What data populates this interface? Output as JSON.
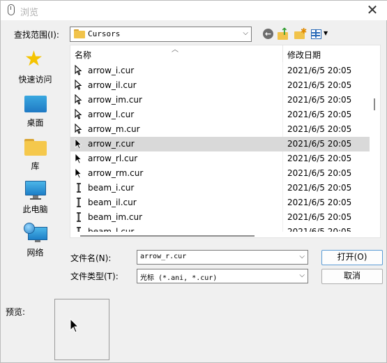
{
  "window": {
    "title": "浏览",
    "close_glyph": "✕"
  },
  "lookin": {
    "label": "查找范围(I):",
    "value": "Cursors",
    "icon": "folder-icon"
  },
  "toolbar": {
    "back_icon": "back-arrow-icon",
    "up_icon": "up-folder-icon",
    "new_folder_icon": "new-folder-icon",
    "view_menu_icon": "view-menu-icon"
  },
  "places": [
    {
      "label": "快速访问",
      "icon": "star-icon"
    },
    {
      "label": "桌面",
      "icon": "desktop-icon"
    },
    {
      "label": "库",
      "icon": "library-icon"
    },
    {
      "label": "此电脑",
      "icon": "computer-icon"
    },
    {
      "label": "网络",
      "icon": "network-icon"
    }
  ],
  "filelist": {
    "columns": {
      "name": "名称",
      "modified": "修改日期"
    },
    "rows": [
      {
        "name": "arrow_i.cur",
        "date": "2021/6/5 20:05",
        "kind": "arrow",
        "selected": false
      },
      {
        "name": "arrow_il.cur",
        "date": "2021/6/5 20:05",
        "kind": "arrow",
        "selected": false
      },
      {
        "name": "arrow_im.cur",
        "date": "2021/6/5 20:05",
        "kind": "arrow",
        "selected": false
      },
      {
        "name": "arrow_l.cur",
        "date": "2021/6/5 20:05",
        "kind": "arrow",
        "selected": false
      },
      {
        "name": "arrow_m.cur",
        "date": "2021/6/5 20:05",
        "kind": "arrow",
        "selected": false
      },
      {
        "name": "arrow_r.cur",
        "date": "2021/6/5 20:05",
        "kind": "arrow-black",
        "selected": true
      },
      {
        "name": "arrow_rl.cur",
        "date": "2021/6/5 20:05",
        "kind": "arrow-black",
        "selected": false
      },
      {
        "name": "arrow_rm.cur",
        "date": "2021/6/5 20:05",
        "kind": "arrow-black",
        "selected": false
      },
      {
        "name": "beam_i.cur",
        "date": "2021/6/5 20:05",
        "kind": "beam",
        "selected": false
      },
      {
        "name": "beam_il.cur",
        "date": "2021/6/5 20:05",
        "kind": "beam",
        "selected": false
      },
      {
        "name": "beam_im.cur",
        "date": "2021/6/5 20:05",
        "kind": "beam",
        "selected": false
      },
      {
        "name": "beam_l.cur",
        "date": "2021/6/5 20:05",
        "kind": "beam",
        "selected": false
      }
    ]
  },
  "filename": {
    "label": "文件名(N):",
    "value": "arrow_r.cur"
  },
  "filetype": {
    "label": "文件类型(T):",
    "value": "光标 (*.ani, *.cur)"
  },
  "buttons": {
    "open": "打开(O)",
    "cancel": "取消"
  },
  "preview": {
    "label": "预览:"
  }
}
